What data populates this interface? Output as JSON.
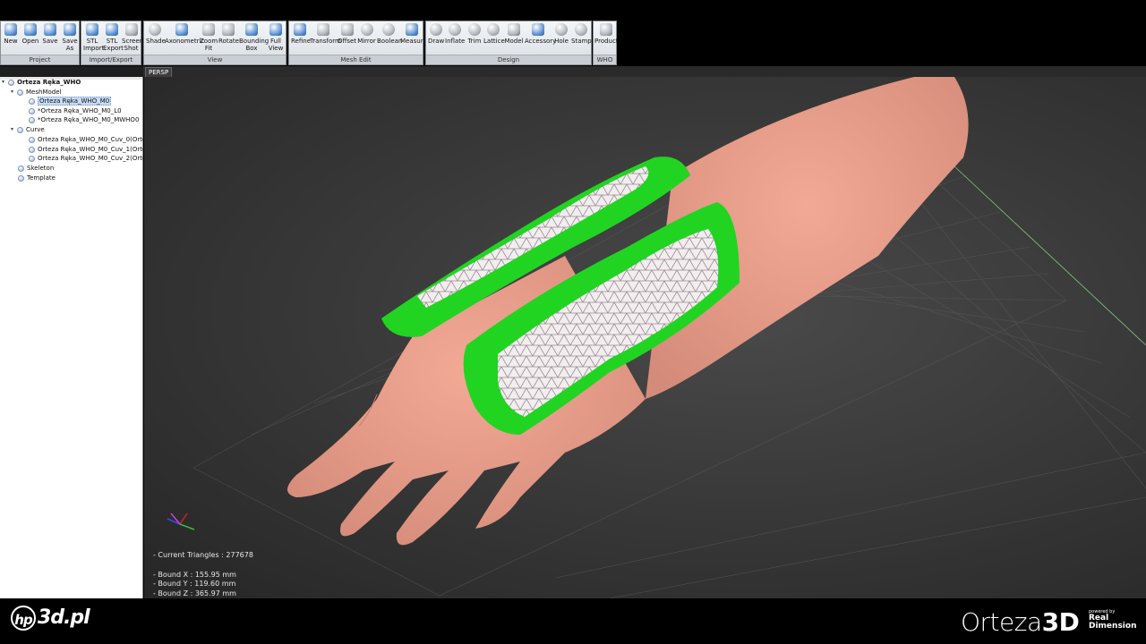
{
  "ribbon": {
    "groups": [
      {
        "name": "Project",
        "buttons": [
          "New",
          "Open",
          "Save",
          "Save As"
        ]
      },
      {
        "name": "Import/Export",
        "buttons": [
          "STL Import",
          "STL Export",
          "Screen Shot"
        ]
      },
      {
        "name": "View",
        "buttons": [
          "Shade",
          "Axonometric",
          "Zoom Fit",
          "Rotate",
          "Bounding Box",
          "Full View"
        ]
      },
      {
        "name": "Mesh Edit",
        "buttons": [
          "Refine",
          "Transform",
          "Offset",
          "Mirror",
          "Boolean",
          "Measure"
        ]
      },
      {
        "name": "Design",
        "buttons": [
          "Draw",
          "Inflate",
          "Trim",
          "Lattice",
          "Model",
          "Accessory",
          "Hole",
          "Stamp"
        ]
      },
      {
        "name": "WHO",
        "buttons": [
          "Product"
        ]
      }
    ]
  },
  "tree": {
    "root": "Orteza Ręka_WHO",
    "mesh_model": "MeshModel",
    "mesh_items": [
      "Orteza Ręka_WHO_M0",
      "*Orteza Ręka_WHO_M0_L0",
      "*Orteza Ręka_WHO_M0_MWHO0"
    ],
    "curve": "Curve",
    "curve_items": [
      "Orteza Ręka_WHO_M0_Cuv_0(Orteza",
      "Orteza Ręka_WHO_M0_Cuv_1(Orteza",
      "Orteza Ręka_WHO_M0_Cuv_2(Orteza"
    ],
    "skeleton": "Skeleton",
    "template": "Template"
  },
  "viewport": {
    "tab": "PERSP",
    "current_triangles": "- Current Triangles : 277678",
    "bound_x": "- Bound X : 155.95 mm",
    "bound_y": "- Bound Y : 119.60 mm",
    "bound_z": "- Bound Z : 365.97 mm"
  },
  "footer": {
    "left_logo_mark": "hp",
    "left_logo_text": "3d.pl",
    "brand_main": "Orteza",
    "brand_bold": "3D",
    "powered_by": "powered by",
    "powered_brand_1": "Real",
    "powered_brand_2": "Dimension"
  }
}
